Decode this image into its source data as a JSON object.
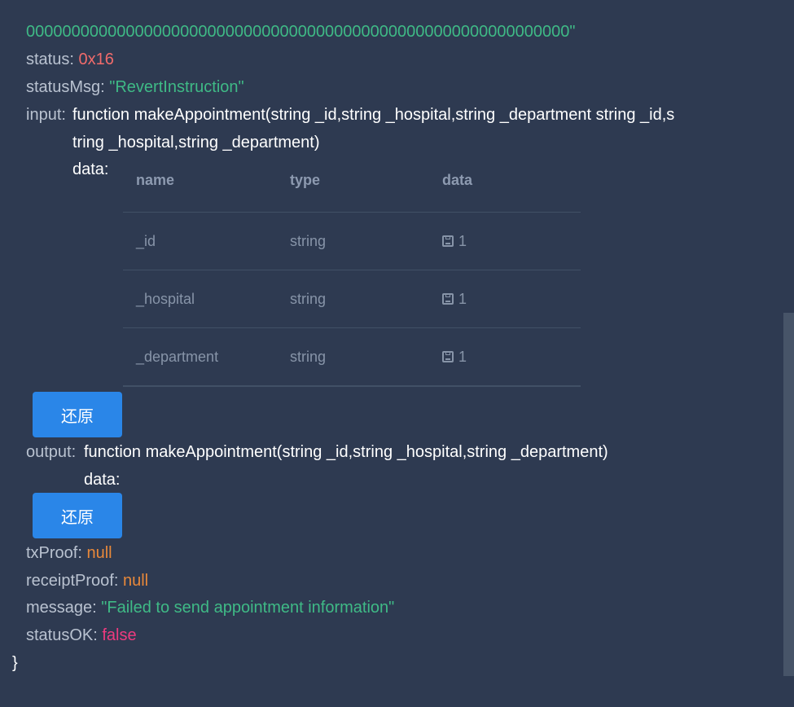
{
  "hash_tail": "000000000000000000000000000000000000000000000000000000000000\"",
  "status": {
    "key": "status:",
    "value": "0x16"
  },
  "statusMsg": {
    "key": "statusMsg:",
    "value": "\"RevertInstruction\""
  },
  "input": {
    "key": "input:",
    "fn_line1": "function  makeAppointment(string _id,string _hospital,string _department string _id,s",
    "fn_line2": "tring _hospital,string _department)",
    "data_label": "data:",
    "table": {
      "headers": [
        "name",
        "type",
        "data"
      ],
      "rows": [
        {
          "name": "_id",
          "type": "string",
          "data": "1"
        },
        {
          "name": "_hospital",
          "type": "string",
          "data": "1"
        },
        {
          "name": "_department",
          "type": "string",
          "data": "1"
        }
      ]
    },
    "button_label": "还原"
  },
  "output": {
    "key": "output:",
    "fn_line": "function  makeAppointment(string _id,string _hospital,string _department)",
    "data_label": "data:",
    "button_label": "还原"
  },
  "txProof": {
    "key": "txProof:",
    "value": "null"
  },
  "receiptProof": {
    "key": "receiptProof:",
    "value": "null"
  },
  "message": {
    "key": "message:",
    "value": "\"Failed to send appointment information\""
  },
  "statusOK": {
    "key": "statusOK:",
    "value": "false"
  },
  "closing_brace": "}",
  "colors": {
    "background": "#2e3a51",
    "string": "#3fba86",
    "number": "#f06b6b",
    "null": "#e8883a",
    "boolean": "#ee3a7f",
    "button": "#2a86e8"
  }
}
